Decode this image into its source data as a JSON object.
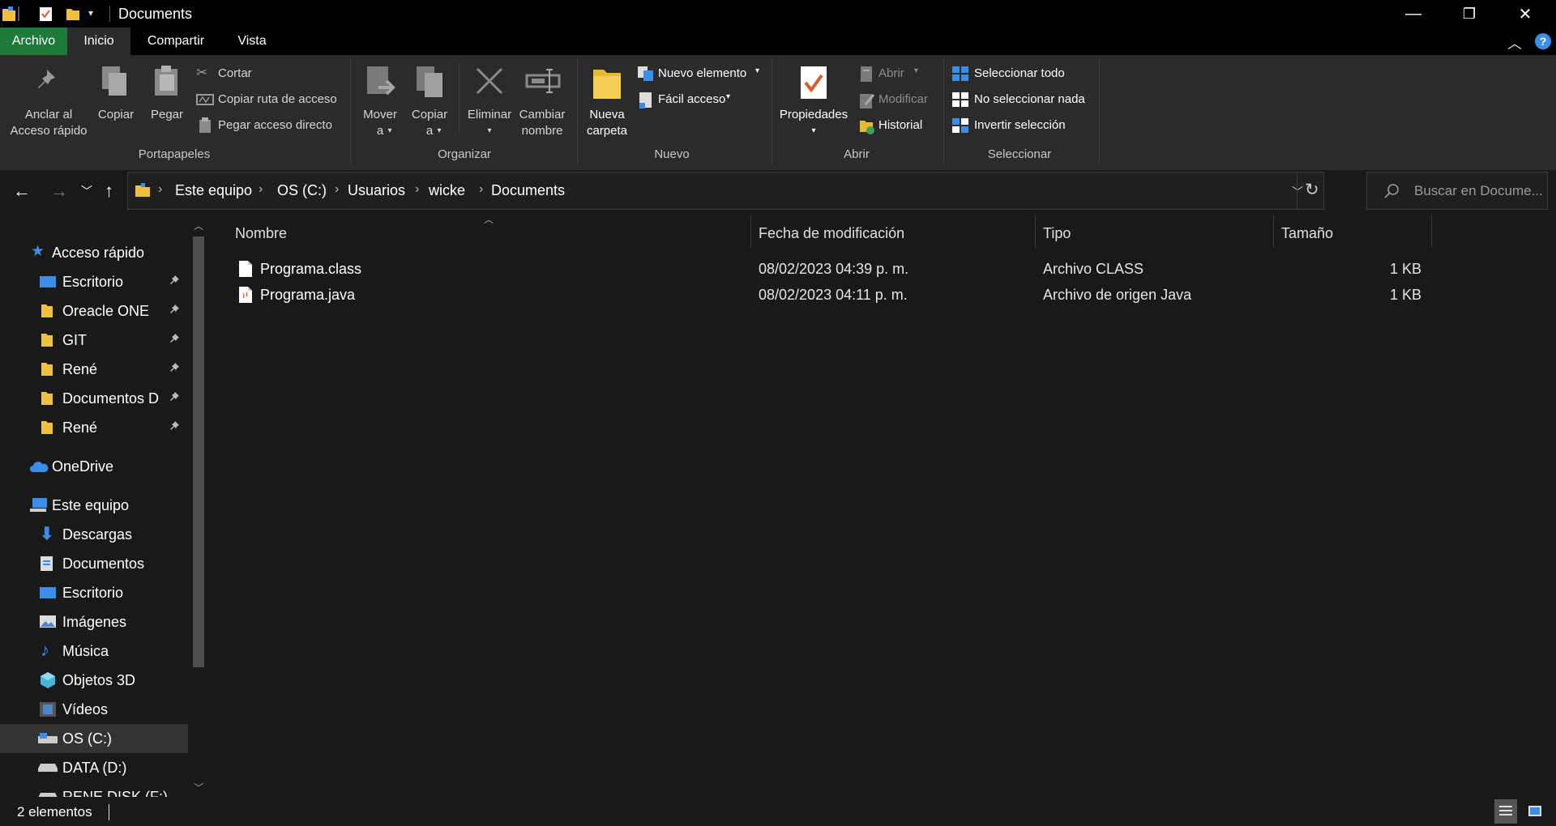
{
  "window": {
    "title": "Documents",
    "controls": {
      "minimize": "—",
      "maximize": "❐",
      "close": "✕"
    }
  },
  "ribbon_tabs": [
    "Archivo",
    "Inicio",
    "Compartir",
    "Vista"
  ],
  "ribbon": {
    "portapapeles": {
      "group_label": "Portapapeles",
      "pin_label_1": "Anclar al",
      "pin_label_2": "Acceso rápido",
      "copy": "Copiar",
      "paste": "Pegar",
      "cut": "Cortar",
      "copy_path": "Copiar ruta de acceso",
      "paste_shortcut": "Pegar acceso directo"
    },
    "organizar": {
      "group_label": "Organizar",
      "move_1": "Mover",
      "move_2": "a",
      "copy_1": "Copiar",
      "copy_2": "a",
      "delete": "Eliminar",
      "rename_1": "Cambiar",
      "rename_2": "nombre"
    },
    "nuevo": {
      "group_label": "Nuevo",
      "new_folder_1": "Nueva",
      "new_folder_2": "carpeta",
      "new_item": "Nuevo elemento",
      "easy_access": "Fácil acceso"
    },
    "abrir": {
      "group_label": "Abrir",
      "properties": "Propiedades",
      "open": "Abrir",
      "edit": "Modificar",
      "history": "Historial"
    },
    "seleccionar": {
      "group_label": "Seleccionar",
      "select_all": "Seleccionar todo",
      "select_none": "No seleccionar nada",
      "invert": "Invertir selección"
    }
  },
  "address": {
    "crumbs": [
      "Este equipo",
      "OS (C:)",
      "Usuarios",
      "wicke",
      "Documents"
    ],
    "search_placeholder": "Buscar en Docume..."
  },
  "sidebar": {
    "quick_access": "Acceso rápido",
    "quick_items": [
      "Escritorio",
      "Oreacle ONE",
      "GIT",
      "René",
      "Documentos D",
      "René"
    ],
    "onedrive": "OneDrive",
    "this_pc": "Este equipo",
    "pc_items": [
      "Descargas",
      "Documentos",
      "Escritorio",
      "Imágenes",
      "Música",
      "Objetos 3D",
      "Vídeos",
      "OS (C:)",
      "DATA (D:)",
      "RENE DISK (F:)"
    ]
  },
  "columns": [
    "Nombre",
    "Fecha de modificación",
    "Tipo",
    "Tamaño"
  ],
  "files": [
    {
      "name": "Programa.class",
      "date": "08/02/2023 04:39 p. m.",
      "type": "Archivo CLASS",
      "size": "1 KB"
    },
    {
      "name": "Programa.java",
      "date": "08/02/2023 04:11 p. m.",
      "type": "Archivo de origen Java",
      "size": "1 KB"
    }
  ],
  "status": {
    "count": "2 elementos"
  },
  "colors": {
    "archivo_tab": "#1e7a3a",
    "folder": "#f0c040",
    "accent_blue": "#3b8ee8",
    "selected_row": "#333333"
  }
}
